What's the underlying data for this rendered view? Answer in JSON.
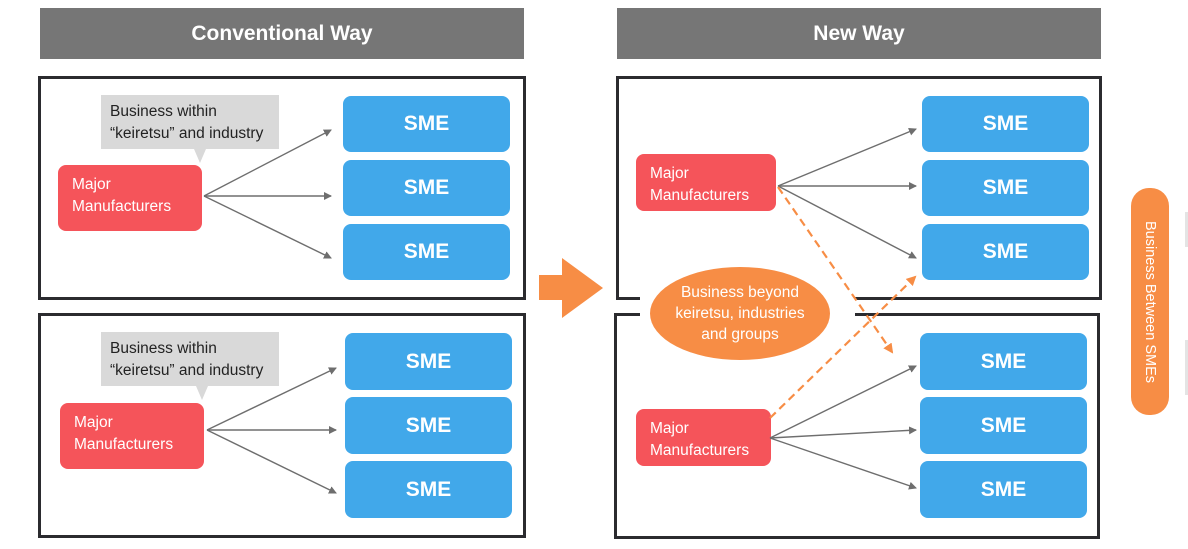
{
  "conventional": {
    "title": "Conventional Way",
    "groups": [
      {
        "manufacturer": [
          "Major",
          "Manufacturers"
        ],
        "callout": [
          "Business within",
          "“keiretsu” and industry"
        ],
        "smes": [
          "SME",
          "SME",
          "SME"
        ]
      },
      {
        "manufacturer": [
          "Major",
          "Manufacturers"
        ],
        "callout": [
          "Business within",
          "“keiretsu” and industry"
        ],
        "smes": [
          "SME",
          "SME",
          "SME"
        ]
      }
    ]
  },
  "new_way": {
    "title": "New Way",
    "groups": [
      {
        "manufacturer": [
          "Major",
          "Manufacturers"
        ],
        "smes": [
          "SME",
          "SME",
          "SME"
        ]
      },
      {
        "manufacturer": [
          "Major",
          "Manufacturers"
        ],
        "smes": [
          "SME",
          "SME",
          "SME"
        ]
      }
    ],
    "beyond_label": [
      "Business beyond",
      "keiretsu, industries",
      "and groups"
    ],
    "side_label": "Business Between SMEs"
  },
  "colors": {
    "header": "#767676",
    "sme": "#41a8ea",
    "manufacturer": "#f5545a",
    "accent_orange": "#f78d45",
    "callout": "#d9d9d9",
    "arrow": "#6e6e6e"
  }
}
